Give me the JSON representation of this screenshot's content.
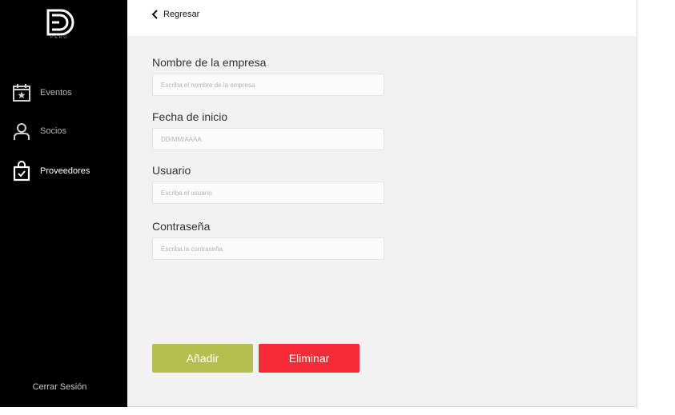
{
  "sidebar": {
    "logo_caption": "PERÚ",
    "items": [
      {
        "label": "Eventos",
        "icon": "calendar-star-icon",
        "active": false
      },
      {
        "label": "Socios",
        "icon": "user-icon",
        "active": false
      },
      {
        "label": "Proveedores",
        "icon": "shopping-bag-check-icon",
        "active": true
      }
    ],
    "logout_label": "Cerrar Sesión"
  },
  "topbar": {
    "back_label": "Regresar",
    "back_icon": "chevron-left-icon"
  },
  "form": {
    "company": {
      "label": "Nombre de la empresa",
      "placeholder": "Escriba el nombre de la empresa",
      "value": ""
    },
    "start_date": {
      "label": "Fecha de inicio",
      "placeholder": "DD/MM/AAAA",
      "value": ""
    },
    "user": {
      "label": "Usuario",
      "placeholder": "Escriba el usuario",
      "value": ""
    },
    "password": {
      "label": "Contraseña",
      "placeholder": "Escriba la contraseña",
      "value": ""
    }
  },
  "actions": {
    "add_label": "Añadir",
    "delete_label": "Eliminar"
  },
  "colors": {
    "sidebar_bg": "#000000",
    "main_bg": "#f2f2f2",
    "add_button": "#b4bf4f",
    "delete_button": "#f62b38"
  }
}
